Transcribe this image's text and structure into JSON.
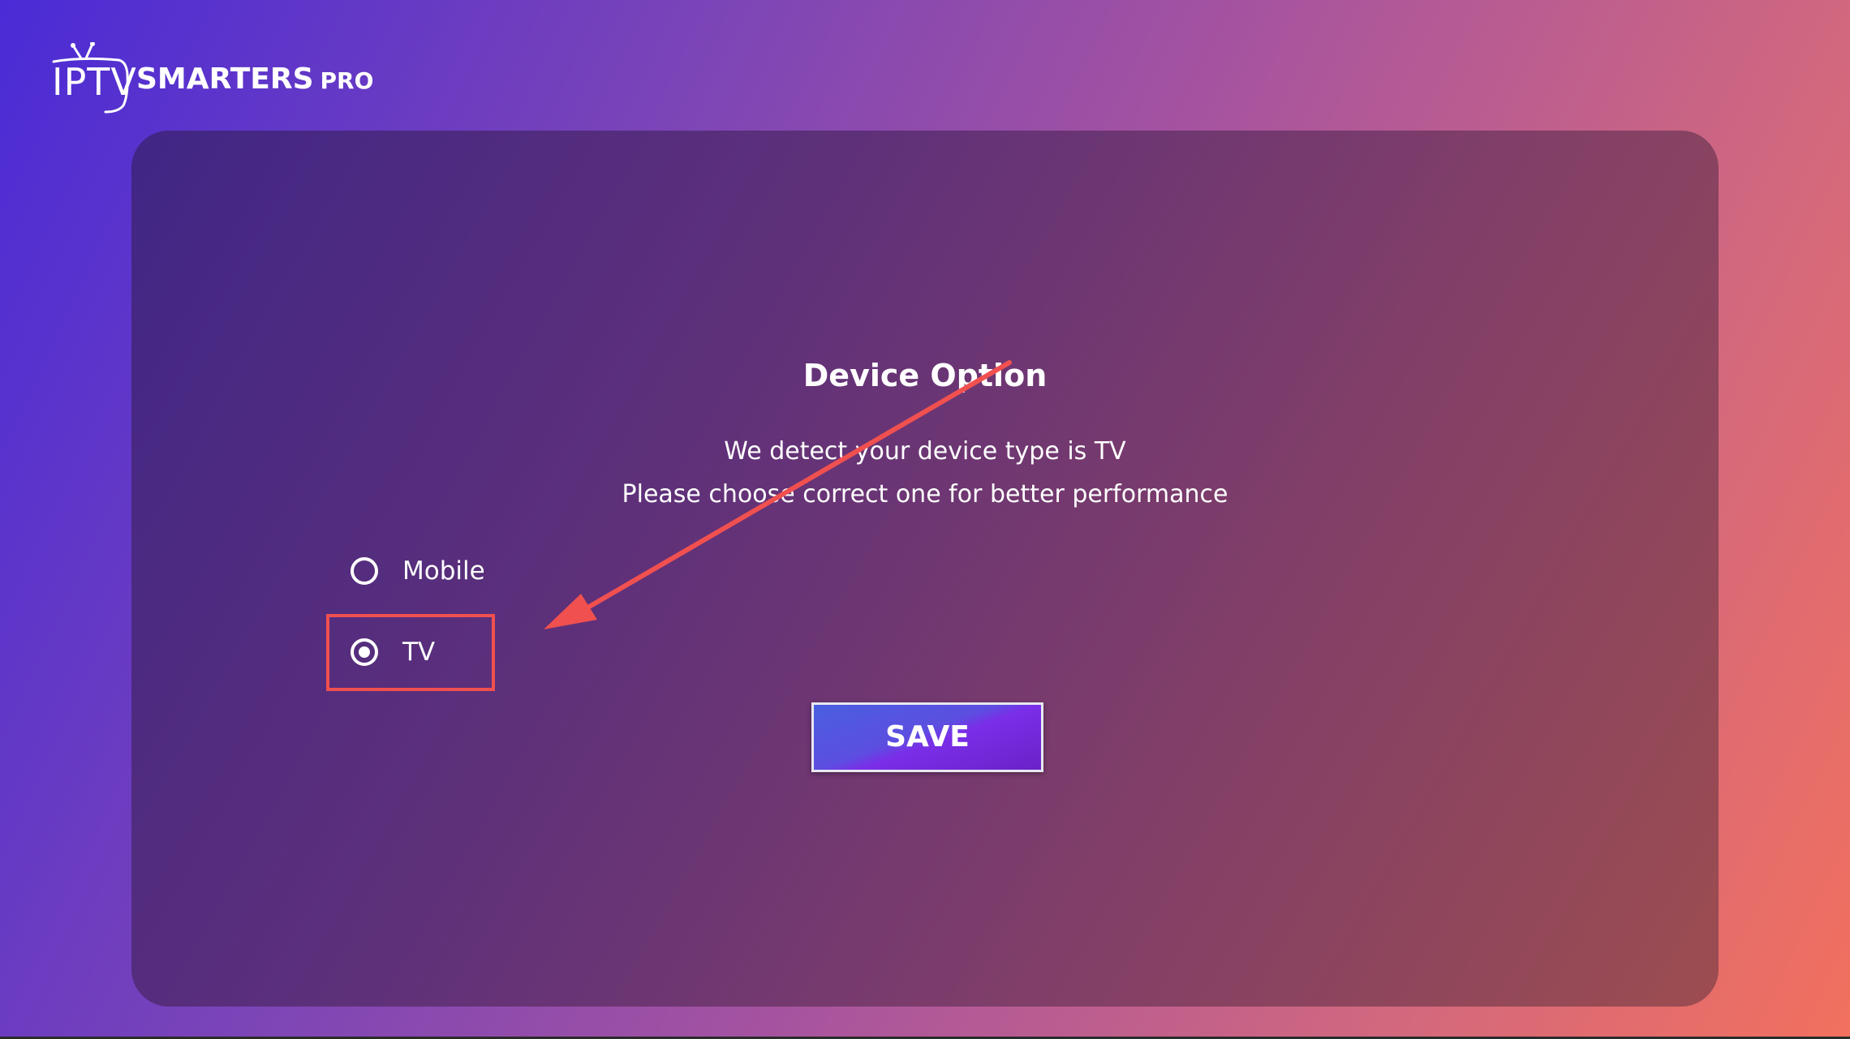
{
  "logo": {
    "iptv": "IPTV",
    "smarters": "SMARTERS",
    "pro": "PRO"
  },
  "dialog": {
    "title": "Device Option",
    "line1": "We detect your device type is TV",
    "line2": "Please choose correct one for better performance"
  },
  "options": [
    {
      "label": "Mobile",
      "selected": false
    },
    {
      "label": "TV",
      "selected": true
    }
  ],
  "save_label": "SAVE",
  "colors": {
    "accent_red": "#f0504f",
    "button_blue": "#4a5fe0",
    "button_purple": "#7a2ee8"
  },
  "icons": {
    "logo_tv": "tv-antenna-icon",
    "annotation": "red-arrow-icon"
  }
}
